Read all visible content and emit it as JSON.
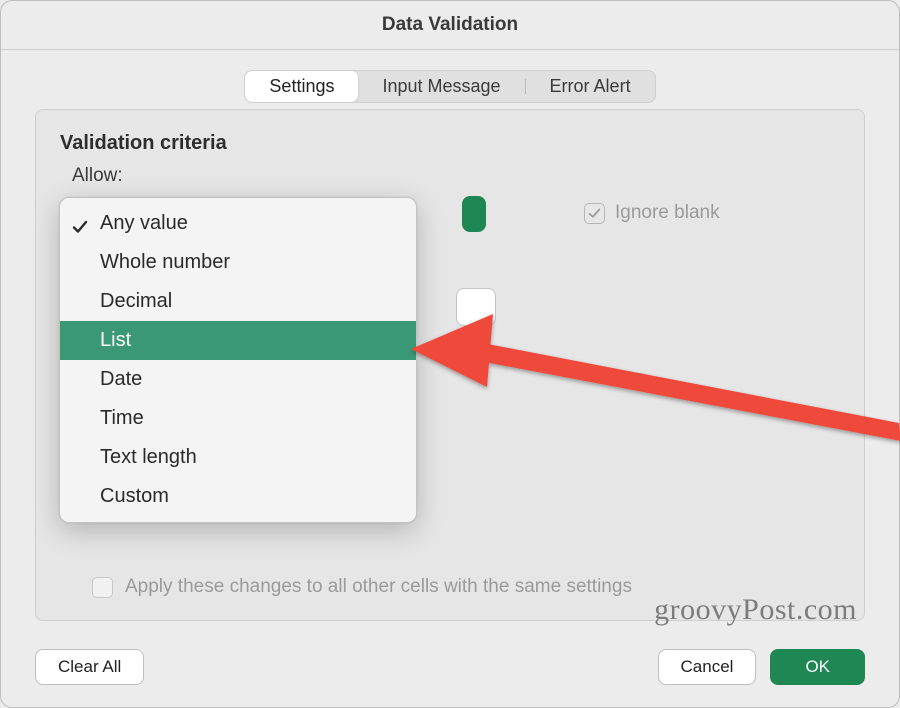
{
  "title": "Data Validation",
  "tabs": {
    "settings": "Settings",
    "input_message": "Input Message",
    "error_alert": "Error Alert"
  },
  "section_heading": "Validation criteria",
  "allow_label": "Allow:",
  "ignore_blank_label": "Ignore blank",
  "apply_label": "Apply these changes to all other cells with the same settings",
  "dropdown": {
    "selected": "Any value",
    "highlighted": "List",
    "options": {
      "any_value": "Any value",
      "whole_number": "Whole number",
      "decimal": "Decimal",
      "list": "List",
      "date": "Date",
      "time": "Time",
      "text_length": "Text length",
      "custom": "Custom"
    }
  },
  "buttons": {
    "clear_all": "Clear All",
    "cancel": "Cancel",
    "ok": "OK"
  },
  "watermark": "groovyPost.com",
  "colors": {
    "accent_green": "#1e8754",
    "highlight_green": "#3a9974",
    "arrow_red": "#ef4a3a"
  }
}
